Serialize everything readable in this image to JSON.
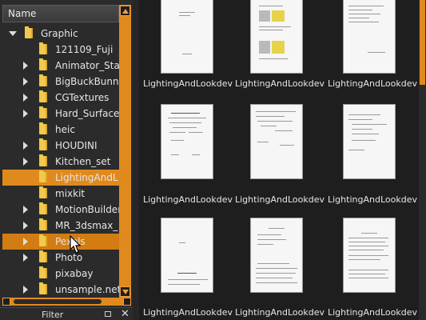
{
  "tree": {
    "header": "Name",
    "items": [
      {
        "label": "Graphic",
        "arrow": "down",
        "level": 0
      },
      {
        "label": "121109_Fuji",
        "arrow": "none",
        "level": 1
      },
      {
        "label": "Animator_Sta",
        "arrow": "right",
        "level": 1
      },
      {
        "label": "BigBuckBunny",
        "arrow": "right",
        "level": 1
      },
      {
        "label": "CGTextures",
        "arrow": "right",
        "level": 1
      },
      {
        "label": "Hard_Surface",
        "arrow": "right",
        "level": 1
      },
      {
        "label": "heic",
        "arrow": "none",
        "level": 1
      },
      {
        "label": "HOUDINI",
        "arrow": "right",
        "level": 1
      },
      {
        "label": "Kitchen_set",
        "arrow": "right",
        "level": 1
      },
      {
        "label": "LightingAndL",
        "arrow": "none",
        "level": 1,
        "state": "selected"
      },
      {
        "label": "mixkit",
        "arrow": "none",
        "level": 1
      },
      {
        "label": "MotionBuilder",
        "arrow": "right",
        "level": 1
      },
      {
        "label": "MR_3dsmax_",
        "arrow": "right",
        "level": 1
      },
      {
        "label": "Pexels",
        "arrow": "right",
        "level": 1,
        "state": "hover"
      },
      {
        "label": "Photo",
        "arrow": "right",
        "level": 1
      },
      {
        "label": "pixabay",
        "arrow": "none",
        "level": 1
      },
      {
        "label": "unsample.net",
        "arrow": "right",
        "level": 1
      }
    ]
  },
  "filter_bar": {
    "label": "Filter"
  },
  "thumbnails": [
    {
      "label": "LightingAndLookdev"
    },
    {
      "label": "LightingAndLookdev"
    },
    {
      "label": "LightingAndLookdev"
    },
    {
      "label": "LightingAndLookdev"
    },
    {
      "label": "LightingAndLookdev"
    },
    {
      "label": "LightingAndLookdev"
    },
    {
      "label": "LightingAndLookdev"
    },
    {
      "label": "LightingAndLookdev"
    },
    {
      "label": "LightingAndLookdev"
    }
  ],
  "colors": {
    "accent": "#e08a1e",
    "folder": "#f2c94c",
    "background": "#1e1e1e"
  }
}
